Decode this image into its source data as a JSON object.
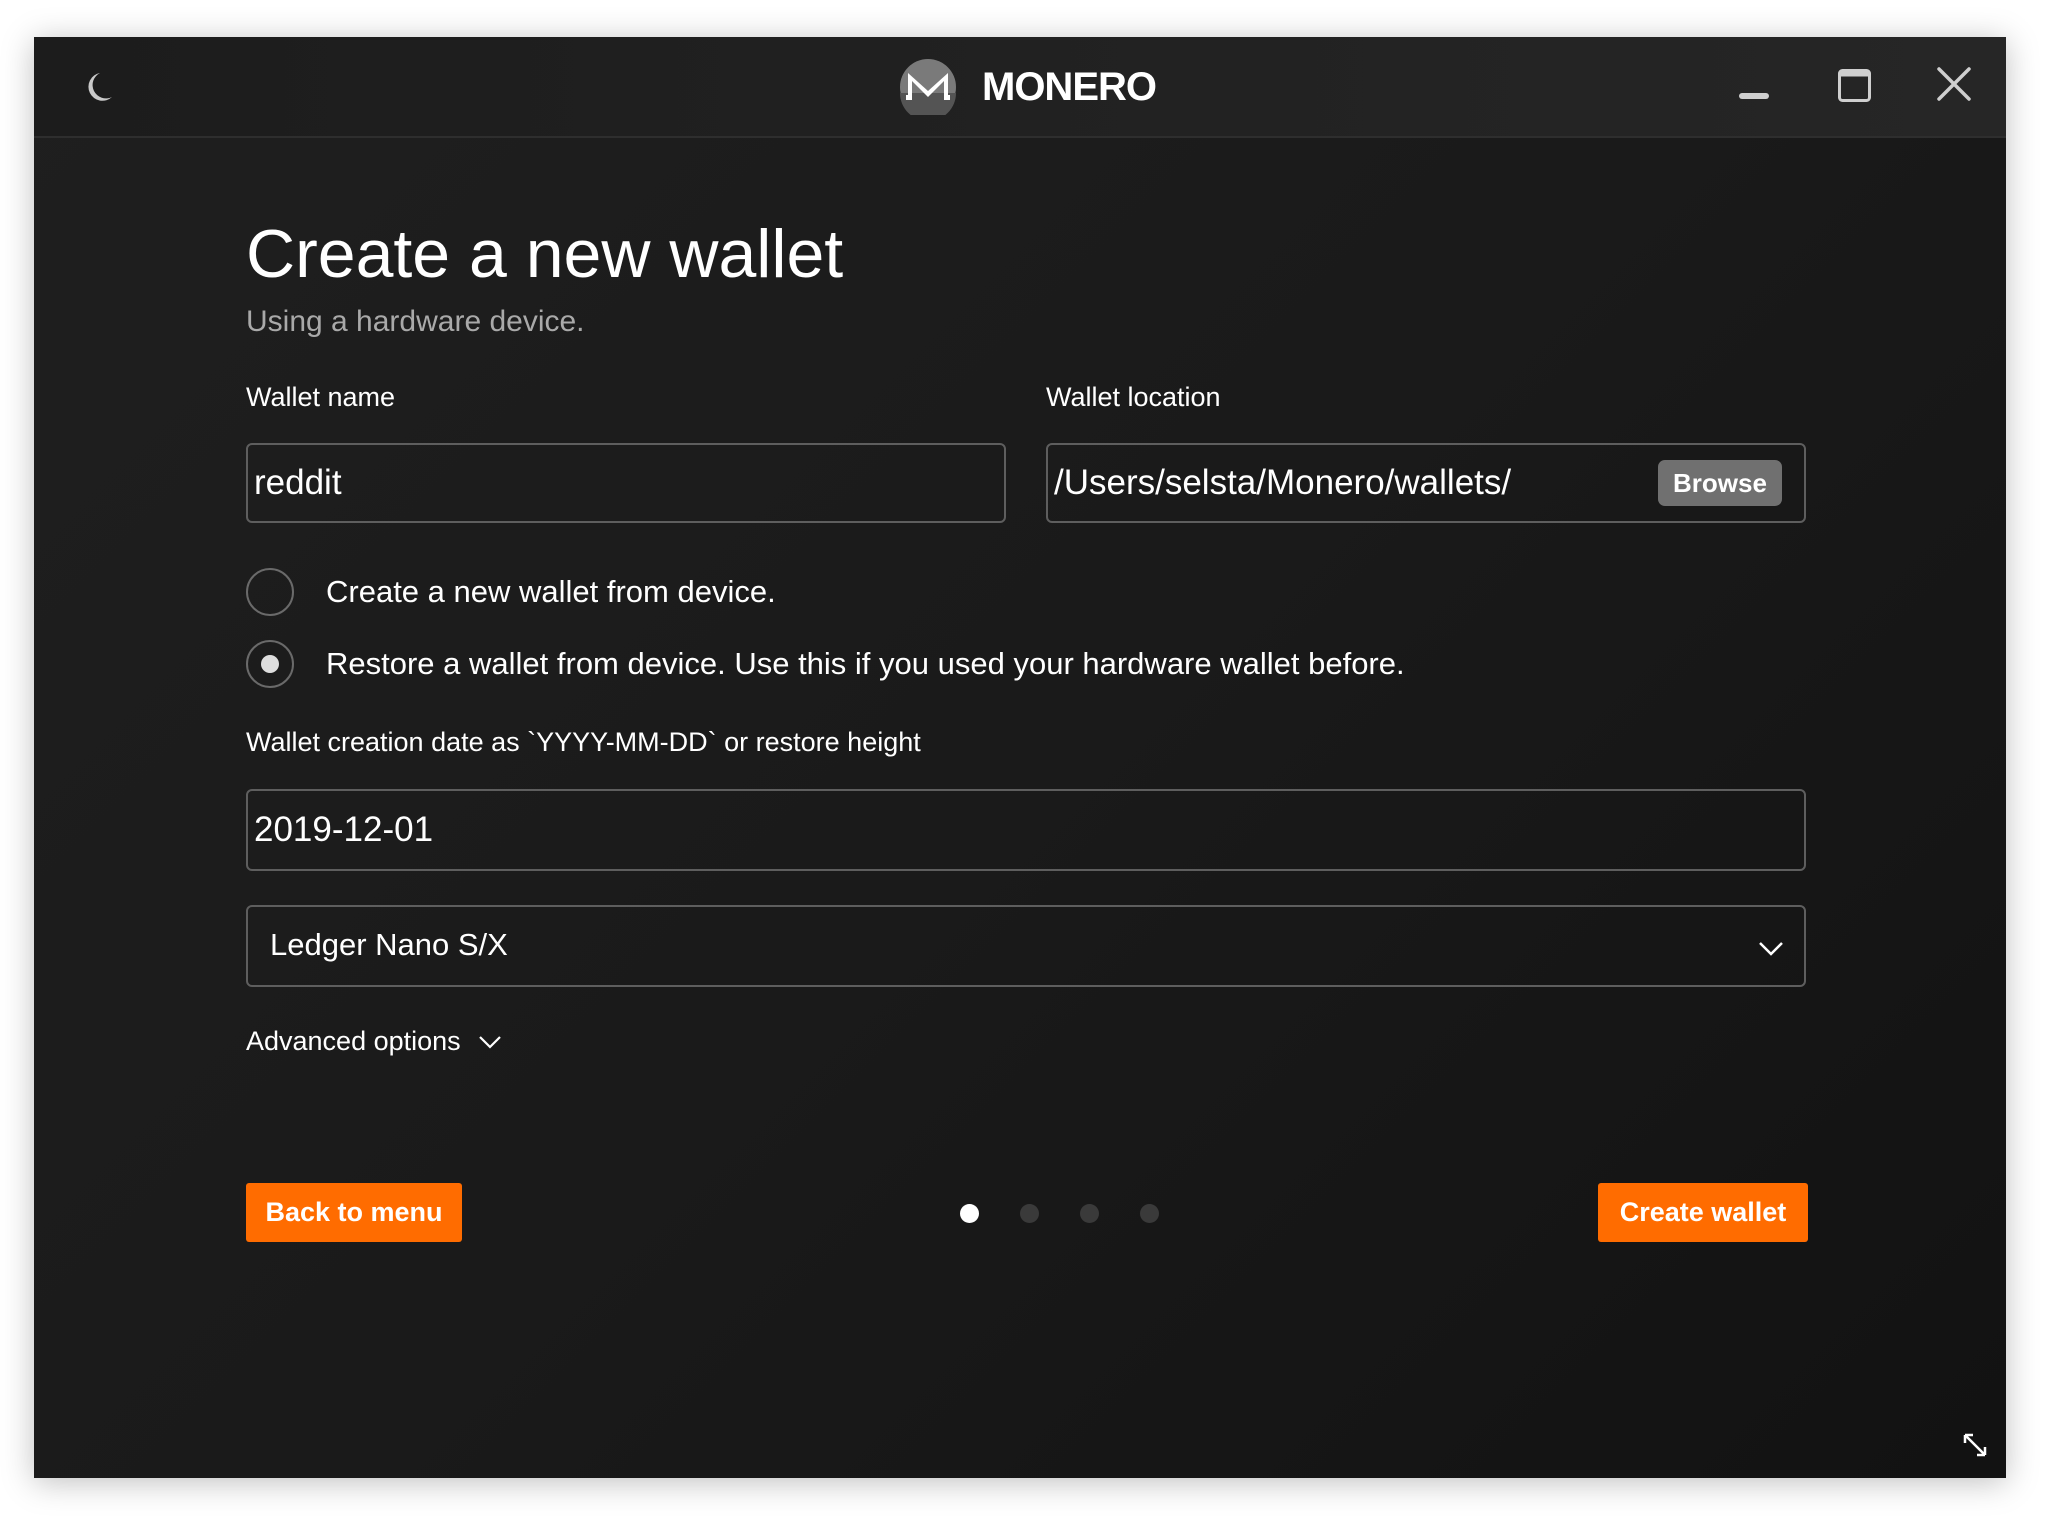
{
  "titlebar": {
    "app_name": "MONERO",
    "theme_toggle_icon": "moon-icon",
    "logo_icon": "monero-logo",
    "controls": {
      "minimize_icon": "minimize-icon",
      "maximize_icon": "maximize-icon",
      "close_icon": "close-icon"
    }
  },
  "page": {
    "title": "Create a new wallet",
    "subtitle": "Using a hardware device."
  },
  "form": {
    "wallet_name": {
      "label": "Wallet name",
      "value": "reddit"
    },
    "wallet_location": {
      "label": "Wallet location",
      "value": "/Users/selsta/Monero/wallets/",
      "browse_label": "Browse"
    },
    "mode_options": [
      {
        "label": "Create a new wallet from device.",
        "checked": false
      },
      {
        "label": "Restore a wallet from device. Use this if you used your hardware wallet before.",
        "checked": true
      }
    ],
    "restore_date": {
      "label": "Wallet creation date as `YYYY-MM-DD` or restore height",
      "value": "2019-12-01"
    },
    "device_select": {
      "selected": "Ledger Nano S/X",
      "icon": "chevron-down-icon"
    },
    "advanced_options_label": "Advanced options"
  },
  "footer": {
    "back_label": "Back to menu",
    "create_label": "Create wallet",
    "progress": {
      "current_step": 1,
      "total_steps": 4
    }
  },
  "colors": {
    "accent": "#ff6c00",
    "background": "#1a1a1a",
    "input_border": "#5e5e5e",
    "browse_bg": "#707070",
    "subtitle": "#a9a9a9"
  }
}
